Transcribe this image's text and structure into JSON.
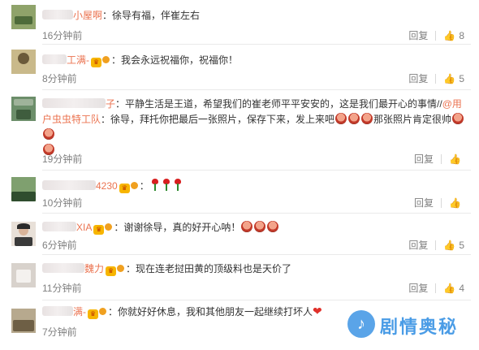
{
  "reply_label": "回复",
  "comments": [
    {
      "name": "小屋啊",
      "text": "：徐导有福，伴崔左右",
      "time": "16分钟前",
      "likes": "8"
    },
    {
      "name": "工满-",
      "text": "：我会永远祝福你，祝福你！",
      "time": "8分钟前",
      "likes": "5"
    },
    {
      "name": "子",
      "text": "：平静生活是王道，希望我们的崔老师平平安安的，这是我们最开心的事情//",
      "link": "@用户虫虫特工队",
      "text2": "：徐导，拜托你把最后一张照片，保存下来，发上来吧",
      "text3": "那张照片肯定很帅",
      "time": "19分钟前",
      "likes": ""
    },
    {
      "name": "4230",
      "text": "：",
      "time": "10分钟前",
      "likes": ""
    },
    {
      "name": "XIA",
      "text": "：谢谢徐导，真的好开心呐！",
      "time": "6分钟前",
      "likes": "5"
    },
    {
      "name": "魏力",
      "text": "：现在连老挝田黄的顶级料也是天价了",
      "time": "11分钟前",
      "likes": "4"
    },
    {
      "name": "满-",
      "text": "：你就好好休息，我和其他朋友一起继续打坏人",
      "time": "7分钟前",
      "likes": ""
    }
  ],
  "watermark": {
    "text": "剧情奥秘"
  },
  "colors": {
    "name": "#eb7350",
    "meta": "#808080",
    "watermark": "#4a9ce6"
  }
}
